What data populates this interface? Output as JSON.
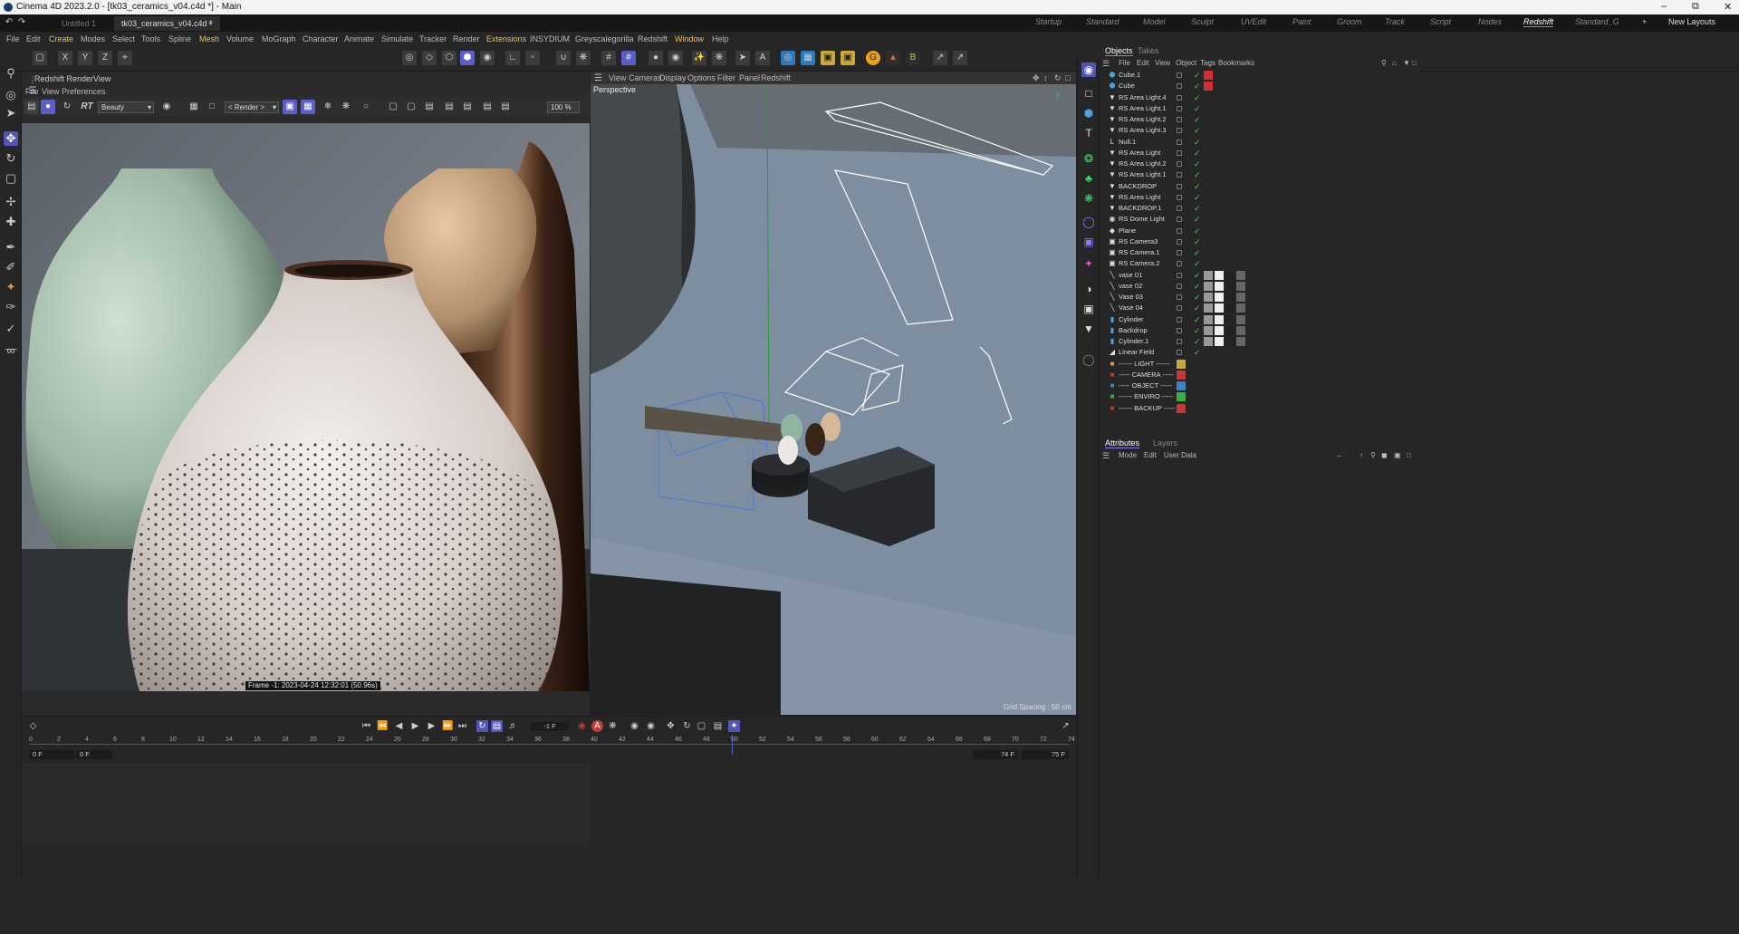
{
  "window": {
    "title": "Cinema 4D 2023.2.0 - [tk03_ceramics_v04.c4d *] - Main"
  },
  "doc_tabs": [
    "Untitled 1",
    "tk03_ceramics_v04.c4d *"
  ],
  "layouts": [
    "Startup",
    "Standard",
    "Model",
    "Sculpt",
    "UVEdit",
    "Paint",
    "Groom",
    "Track",
    "Script",
    "Nodes",
    "Redshift",
    "Standard_G"
  ],
  "new_layouts": "New Layouts",
  "menus": [
    "File",
    "Edit",
    "Create",
    "Modes",
    "Select",
    "Tools",
    "Spline",
    "Mesh",
    "Volume",
    "MoGraph",
    "Character",
    "Animate",
    "Simulate",
    "Tracker",
    "Render",
    "Extensions",
    "INSYDIUM",
    "Greyscalegorilla",
    "Redshift",
    "Window",
    "Help"
  ],
  "axis_toggles": [
    "X",
    "Y",
    "Z"
  ],
  "renderview": {
    "title": "Redshift RenderView",
    "menus": [
      "File",
      "View",
      "Preferences"
    ],
    "rt": "RT",
    "aov": "Beauty",
    "render_mode": "< Render >",
    "zoom": "100 %",
    "frame_info": "Frame  -1:  2023-04-24  12:32:01  (50.96s)"
  },
  "viewport": {
    "menus": [
      "View",
      "Cameras",
      "Display",
      "Options",
      "Filter",
      "Panel",
      "Redshift"
    ],
    "label": "Perspective",
    "grid_spacing": "Grid Spacing : 50 cm"
  },
  "object_manager": {
    "tabs": [
      "Objects",
      "Takes"
    ],
    "menus": [
      "File",
      "Edit",
      "View",
      "Object",
      "Tags",
      "Bookmarks"
    ],
    "rows": [
      {
        "name": "Cube.1",
        "icon": "cube-icon"
      },
      {
        "name": "Cube",
        "icon": "cube-icon"
      },
      {
        "name": "RS Area Light.4",
        "icon": "light-icon"
      },
      {
        "name": "RS Area Light.1",
        "icon": "light-icon"
      },
      {
        "name": "RS Area Light.2",
        "icon": "light-icon"
      },
      {
        "name": "RS Area Light.3",
        "icon": "light-icon"
      },
      {
        "name": "Null.1",
        "icon": "null-icon"
      },
      {
        "name": "RS Area Light",
        "icon": "light-icon"
      },
      {
        "name": "RS Area Light.2",
        "icon": "light-icon"
      },
      {
        "name": "RS Area Light.1",
        "icon": "light-icon"
      },
      {
        "name": "BACKDROP",
        "icon": "light-icon"
      },
      {
        "name": "RS Area Light",
        "icon": "light-icon"
      },
      {
        "name": "BACKDROP.1",
        "icon": "light-icon"
      },
      {
        "name": "RS Dome Light",
        "icon": "dome-light-icon"
      },
      {
        "name": "Plane",
        "icon": "plane-icon"
      },
      {
        "name": "RS Camera3",
        "icon": "camera-icon"
      },
      {
        "name": "RS Camera.1",
        "icon": "camera-icon"
      },
      {
        "name": "RS Camera.2",
        "icon": "camera-icon"
      },
      {
        "name": "vase 01",
        "icon": "lathe-icon"
      },
      {
        "name": "vase 02",
        "icon": "lathe-icon"
      },
      {
        "name": "Vase 03",
        "icon": "lathe-icon"
      },
      {
        "name": "Vase 04",
        "icon": "lathe-icon"
      },
      {
        "name": "Cylinder",
        "icon": "cylinder-icon"
      },
      {
        "name": "Backdrop",
        "icon": "cylinder-icon"
      },
      {
        "name": "Cylinder.1",
        "icon": "cylinder-icon"
      },
      {
        "name": "Linear Field",
        "icon": "field-icon"
      },
      {
        "name": "------ LIGHT ------",
        "icon": "folder-icon"
      },
      {
        "name": "----- CAMERA -----",
        "icon": "folder-icon"
      },
      {
        "name": "----- OBJECT -----",
        "icon": "folder-icon"
      },
      {
        "name": "------ ENVIRO -----",
        "icon": "folder-icon"
      },
      {
        "name": "------ BACKUP -----",
        "icon": "folder-icon"
      }
    ]
  },
  "attributes": {
    "tabs": [
      "Attributes",
      "Layers"
    ],
    "menus": [
      "Mode",
      "Edit",
      "User Data"
    ]
  },
  "timeline": {
    "ticks": [
      "0",
      "2",
      "4",
      "6",
      "8",
      "10",
      "12",
      "14",
      "16",
      "18",
      "20",
      "22",
      "24",
      "26",
      "28",
      "30",
      "32",
      "34",
      "36",
      "38",
      "40",
      "42",
      "44",
      "46",
      "48",
      "50",
      "52",
      "54",
      "56",
      "58",
      "60",
      "62",
      "64",
      "66",
      "68",
      "70",
      "72",
      "74"
    ],
    "current_frame": "-1 F",
    "start": "0 F",
    "min": "0 F",
    "max": "74 F",
    "end": "75 F"
  },
  "colors": {
    "accent": "#5d5fc8",
    "check": "#44d64a",
    "light_folder": "#c9a93a",
    "camera_folder": "#c03a3a",
    "object_folder": "#3a86c0",
    "enviro_folder": "#3ab04a",
    "backup_folder": "#c03a3a"
  }
}
